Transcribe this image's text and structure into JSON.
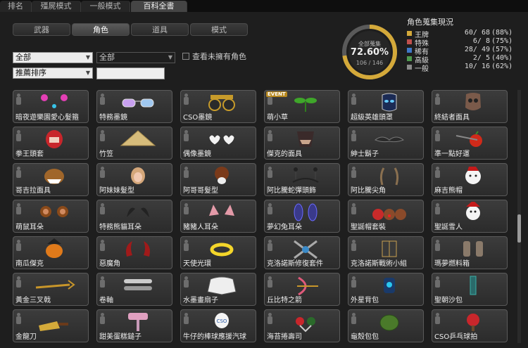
{
  "top_tabs": [
    "排名",
    "殭屍模式",
    "一般模式",
    "百科全書"
  ],
  "sub_tabs": [
    "武器",
    "角色",
    "道具",
    "模式"
  ],
  "filters": {
    "category": "全部",
    "subcategory": "全部",
    "sort": "推薦排序",
    "search_value": "",
    "show_unowned_label": "查看未擁有角色"
  },
  "collection": {
    "title": "全部蒐集",
    "percent": "72.60%",
    "count": "106 / 146"
  },
  "stats": {
    "title": "角色蒐集現況",
    "rows": [
      {
        "name": "王牌",
        "value": "60/  68",
        "pct": "(88%)",
        "color": "#d4a93a"
      },
      {
        "name": "特殊",
        "value": "6/   8",
        "pct": "(75%)",
        "color": "#c0504d"
      },
      {
        "name": "稀有",
        "value": "28/  49",
        "pct": "(57%)",
        "color": "#3f78c8"
      },
      {
        "name": "高級",
        "value": "2/   5",
        "pct": "(40%)",
        "color": "#4f9a4f"
      },
      {
        "name": "一般",
        "value": "10/  16",
        "pct": "(62%)",
        "color": "#8a8a8a"
      }
    ]
  },
  "items": [
    {
      "label": "暗夜遊樂園愛心髮箍",
      "icon": "heart-headband-icon"
    },
    {
      "label": "特務墨鏡",
      "icon": "sunglasses-icon"
    },
    {
      "label": "CSO墨鏡",
      "icon": "party-glasses-icon"
    },
    {
      "label": "萌小草",
      "icon": "sprout-icon",
      "tag": "EVENT"
    },
    {
      "label": "超級英雄頭罩",
      "icon": "hero-mask-icon"
    },
    {
      "label": "終結者面具",
      "icon": "skull-mask-icon"
    },
    {
      "label": "拳王頭套",
      "icon": "boxing-helmet-icon"
    },
    {
      "label": "竹笠",
      "icon": "straw-hat-icon"
    },
    {
      "label": "偶像墨鏡",
      "icon": "heart-glasses-icon"
    },
    {
      "label": "傑克的面具",
      "icon": "jack-mask-icon"
    },
    {
      "label": "紳士鬍子",
      "icon": "mustache-icon"
    },
    {
      "label": "準一點好運",
      "icon": "apple-arrow-icon"
    },
    {
      "label": "哥吉拉面具",
      "icon": "dino-mask-icon"
    },
    {
      "label": "阿妹妹髮型",
      "icon": "hair-icon"
    },
    {
      "label": "阿哥哥髮型",
      "icon": "afro-icon"
    },
    {
      "label": "阿比騰蛇彈頭飾",
      "icon": "spring-headband-icon"
    },
    {
      "label": "阿比騰尖角",
      "icon": "horns-icon"
    },
    {
      "label": "麻吉熊帽",
      "icon": "bear-hat-icon"
    },
    {
      "label": "萌鼠耳朵",
      "icon": "mouse-ears-icon"
    },
    {
      "label": "特務熊貓耳朵",
      "icon": "panda-ears-icon"
    },
    {
      "label": "豬豬人耳朵",
      "icon": "pig-ears-icon"
    },
    {
      "label": "夢幻兔耳朵",
      "icon": "bunny-ears-icon"
    },
    {
      "label": "聖誕帽套裝",
      "icon": "reindeer-set-icon"
    },
    {
      "label": "聖誕雪人",
      "icon": "snowman-icon"
    },
    {
      "label": "南瓜傑克",
      "icon": "pumpkin-icon"
    },
    {
      "label": "惡魔角",
      "icon": "devil-horns-icon"
    },
    {
      "label": "天使光環",
      "icon": "halo-icon"
    },
    {
      "label": "克洛諾斯修復套件",
      "icon": "repair-kit-icon"
    },
    {
      "label": "克洛諾斯戰術小組",
      "icon": "tactical-kit-icon"
    },
    {
      "label": "瑪夢燃料箱",
      "icon": "fuel-tank-icon"
    },
    {
      "label": "黃金三叉戟",
      "icon": "trident-icon"
    },
    {
      "label": "卷軸",
      "icon": "scroll-icon"
    },
    {
      "label": "水墨畫扇子",
      "icon": "fan-icon"
    },
    {
      "label": "丘比特之箭",
      "icon": "cupid-bow-icon"
    },
    {
      "label": "外星背包",
      "icon": "alien-pack-icon"
    },
    {
      "label": "聖朝沙包",
      "icon": "sandbag-icon"
    },
    {
      "label": "金龍刀",
      "icon": "cleaver-icon"
    },
    {
      "label": "甜美蛋糕鎚子",
      "icon": "cake-hammer-icon"
    },
    {
      "label": "牛仔的棒球應援汽球",
      "icon": "balloon-icon"
    },
    {
      "label": "海苔捲壽司",
      "icon": "sushi-icon"
    },
    {
      "label": "龜殼包包",
      "icon": "turtle-shell-icon"
    },
    {
      "label": "CSO乒乓球拍",
      "icon": "pingpong-paddle-icon"
    }
  ]
}
